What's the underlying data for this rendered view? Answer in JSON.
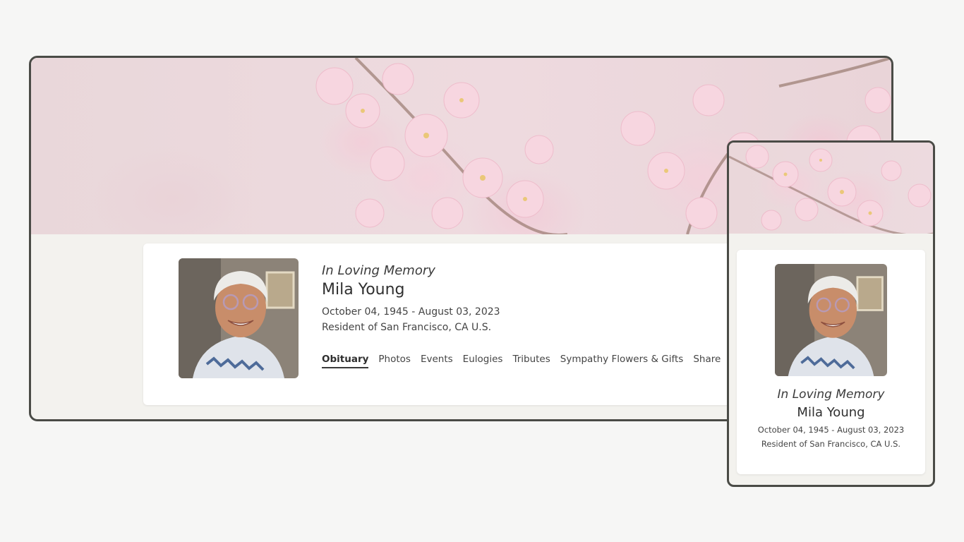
{
  "memorial": {
    "kicker": "In Loving Memory",
    "name": "Mila Young",
    "dates": "October 04, 1945 - August 03, 2023",
    "resident": "Resident of San Francisco, CA U.S."
  },
  "nav": {
    "tabs": [
      {
        "label": "Obituary",
        "active": true
      },
      {
        "label": "Photos"
      },
      {
        "label": "Events"
      },
      {
        "label": "Eulogies"
      },
      {
        "label": "Tributes"
      },
      {
        "label": "Sympathy Flowers & Gifts"
      },
      {
        "label": "Share"
      }
    ]
  },
  "colors": {
    "frame_border": "#4a4b46",
    "page_background": "#f6f6f5",
    "card_background": "#ffffff",
    "blossom_pink": "#f4c9d6"
  }
}
